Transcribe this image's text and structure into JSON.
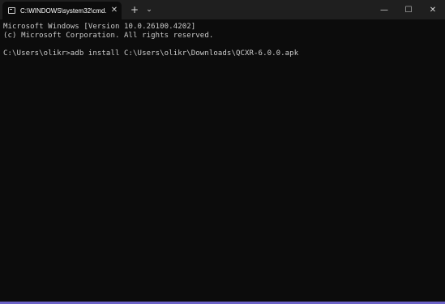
{
  "titlebar": {
    "tab_title": "C:\\WINDOWS\\system32\\cmd.",
    "tab_close": "✕",
    "new_tab": "+",
    "dropdown": "⌄",
    "minimize": "—",
    "maximize": "☐",
    "close": "✕"
  },
  "console": {
    "lines": [
      "Microsoft Windows [Version 10.0.26100.4202]",
      "(c) Microsoft Corporation. All rights reserved.",
      "",
      "C:\\Users\\olikr>adb install C:\\Users\\olikr\\Downloads\\QCXR-6.0.0.apk"
    ]
  },
  "colors": {
    "terminal_background": "#0c0c0c",
    "titlebar_background": "#1f1f1f",
    "text": "#cccccc",
    "bottom_accent": "#6c63c7"
  },
  "icons": [
    "terminal-icon",
    "close-icon",
    "plus-icon",
    "chevron-down-icon",
    "minimize-icon",
    "maximize-icon",
    "close-icon"
  ]
}
